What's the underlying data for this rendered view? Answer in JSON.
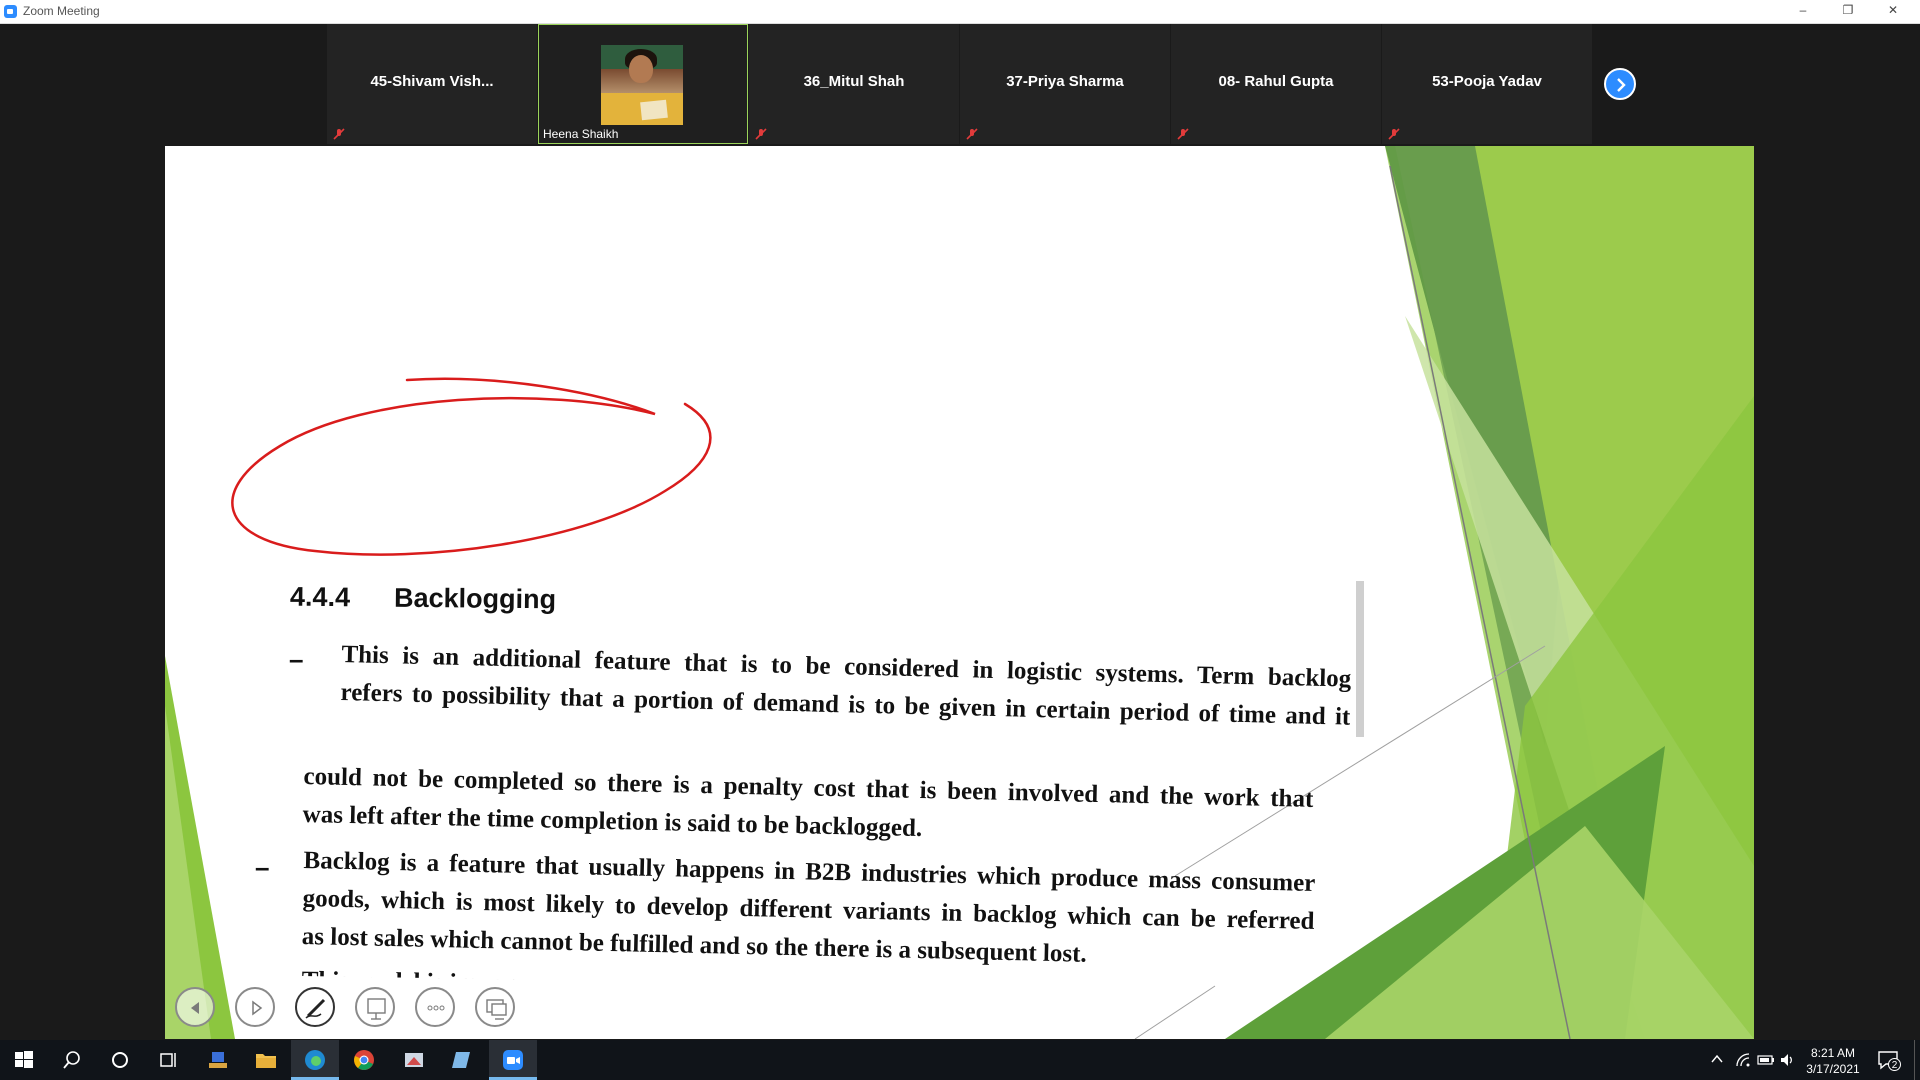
{
  "window": {
    "title": "Zoom Meeting",
    "minimize": "–",
    "restore": "❐",
    "close": "✕"
  },
  "participants": [
    {
      "name": "45-Shivam  Vish...",
      "muted": true
    },
    {
      "name": "Heena Shaikh",
      "video": true,
      "muted": false
    },
    {
      "name": "36_Mitul Shah",
      "muted": true
    },
    {
      "name": "37-Priya Sharma",
      "muted": true
    },
    {
      "name": "08- Rahul Gupta",
      "muted": true
    },
    {
      "name": "53-Pooja Yadav",
      "muted": true
    }
  ],
  "slide": {
    "section_number": "4.4.4",
    "section_title": "Backlogging",
    "para1_line1": "This is an additional feature that is to be considered in logistic systems. Term backlog",
    "para1_line2": "refers to possibility that a portion of demand is to be given in certain period of time and it",
    "para2_line1": "could not be completed so there is a penalty cost that is been involved and the work that",
    "para2_line2": "was left after the time completion is said to be backlogged.",
    "para3_line1": "Backlog is a feature that usually happens in B2B industries which produce mass consumer",
    "para3_line2": "goods, which is most likely to develop different variants in backlog which can be referred",
    "para3_line3": "as lost sales which cannot be fulfilled and so the there is a subsequent lost.",
    "para4_partial": "This model is impor...",
    "dash": "–"
  },
  "slide_controls": [
    "previous-slide",
    "next-slide",
    "pen",
    "presenter-view",
    "more-options",
    "end-show"
  ],
  "taskbar": {
    "apps": [
      "start",
      "search",
      "cortana",
      "task-view",
      "network-app",
      "file-explorer",
      "edge",
      "chrome",
      "snipping-tool",
      "notes",
      "zoom"
    ],
    "time": "8:21 AM",
    "date": "3/17/2021",
    "notifications": "2"
  },
  "colors": {
    "zoom_blue": "#2d8cff",
    "active_speaker": "#9bd45a",
    "annotation_red": "#d91c1c",
    "slide_green": "#8cc63f"
  }
}
